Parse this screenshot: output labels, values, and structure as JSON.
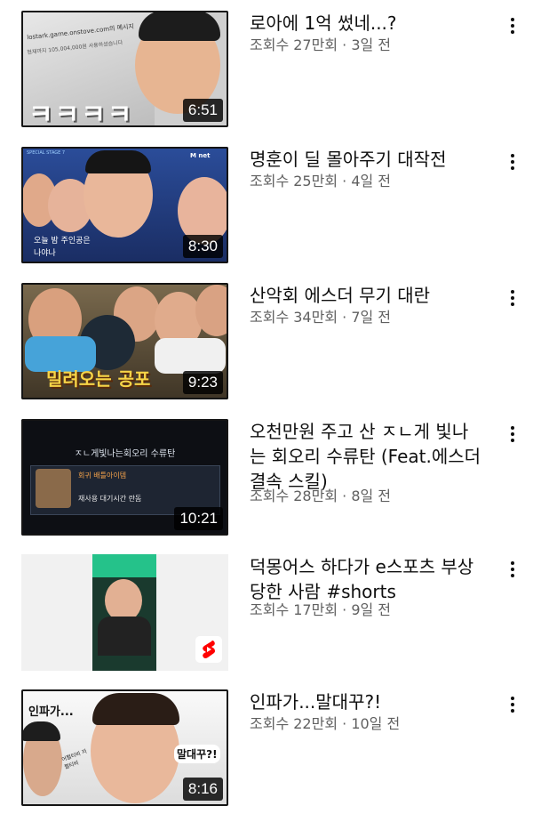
{
  "videos": [
    {
      "title": "로아에 1억 썼네...?",
      "views": "조회수 27만회",
      "age": "3일 전",
      "duration": "6:51",
      "thumb_texts": [
        "lostark.game.onstove.com의 메시지",
        "현재까지 105,004,000원 사용하셨습니다",
        "ㅋㅋㅋㅋ"
      ]
    },
    {
      "title": "명훈이 딜 몰아주기 대작전",
      "views": "조회수 25만회",
      "age": "4일 전",
      "duration": "8:30",
      "thumb_texts": [
        "오늘 밤 주인공은",
        "나야나",
        "SPECIAL STAGE 7",
        "M net"
      ]
    },
    {
      "title": "산악회 에스더 무기 대란",
      "views": "조회수 34만회",
      "age": "7일 전",
      "duration": "9:23",
      "thumb_texts": [
        "밀려오는 공포"
      ]
    },
    {
      "title": "오천만원 주고 산 ㅈㄴ게 빛나는 회오리 수류탄 (Feat.에스더 결속 스킬)",
      "views": "조회수 28만회",
      "age": "8일 전",
      "duration": "10:21",
      "thumb_texts": [
        "ㅈㄴ게빛나는회오리 수류탄",
        "회귀 배틀아이템",
        "재사용 대기시간 란돔"
      ]
    },
    {
      "title": "덕몽어스 하다가 e스포츠 부상당한 사람 #shorts",
      "views": "조회수 17만회",
      "age": "9일 전",
      "duration": "",
      "thumb_texts": []
    },
    {
      "title": "인파가...말대꾸?!",
      "views": "조회수 22만회",
      "age": "10일 전",
      "duration": "8:16",
      "thumb_texts": [
        "인파가...",
        "말대꾸?!",
        "어쩔티비 저쩔티비"
      ]
    }
  ],
  "separator": " · ",
  "colors": {
    "title": "#0f0f0f",
    "meta": "#606060",
    "shorts": "#ff0000"
  }
}
